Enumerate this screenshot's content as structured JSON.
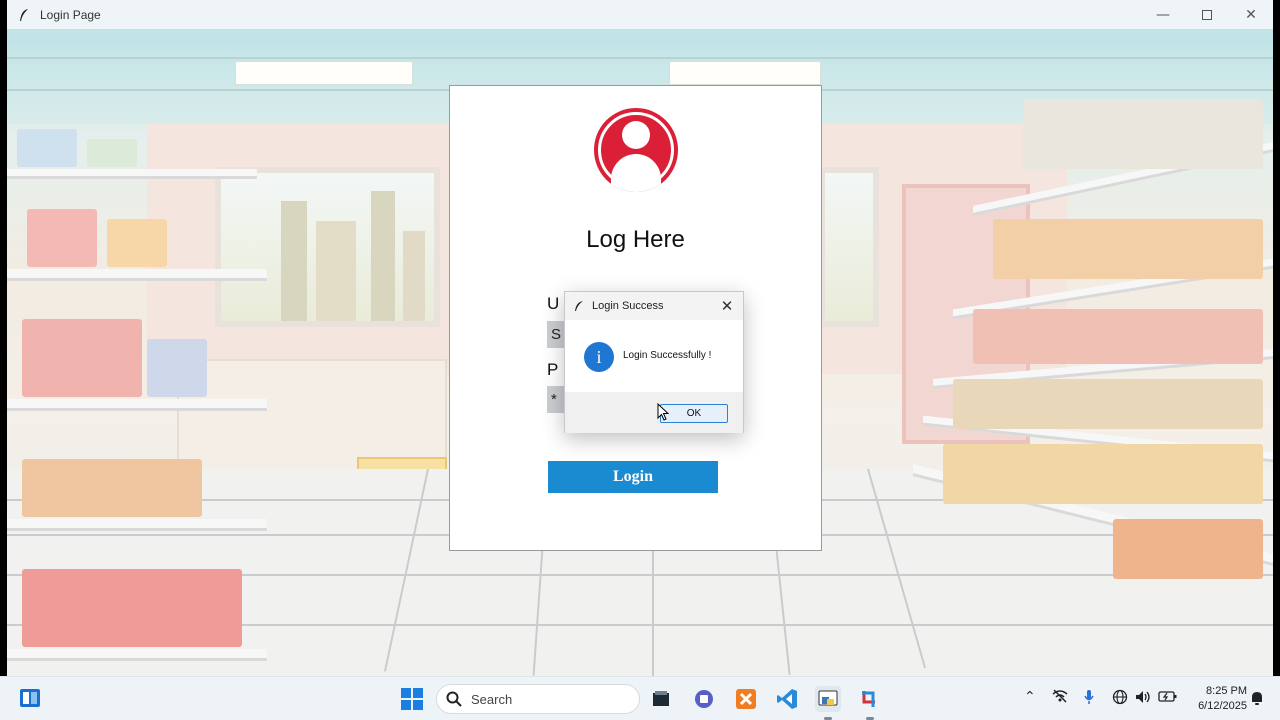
{
  "window": {
    "title": "Login Page"
  },
  "login_panel": {
    "title": "Log Here",
    "username_label": "U",
    "username_value": "S",
    "password_label": "P",
    "password_value": "*",
    "login_button": "Login"
  },
  "dialog": {
    "title": "Login Success",
    "message": "Login Successfully !",
    "ok_button": "OK",
    "info_glyph": "i"
  },
  "taskbar": {
    "search_placeholder": "Search",
    "time": "8:25 PM",
    "date": "6/12/2025"
  },
  "colors": {
    "avatar": "#db1f36",
    "login_button": "#1a8ad1",
    "info_icon": "#1e78d3"
  },
  "icons": [
    "feather-icon",
    "minimize-icon",
    "maximize-icon",
    "close-icon",
    "user-avatar-icon",
    "info-icon",
    "widgets-icon",
    "windows-start-icon",
    "search-icon",
    "file-explorer-icon",
    "teams-icon",
    "xampp-icon",
    "vscode-icon",
    "python-idle-icon",
    "snipping-tool-icon",
    "chevron-up-icon",
    "network-icon",
    "microphone-icon",
    "globe-icon",
    "volume-icon",
    "battery-icon",
    "notification-icon"
  ]
}
